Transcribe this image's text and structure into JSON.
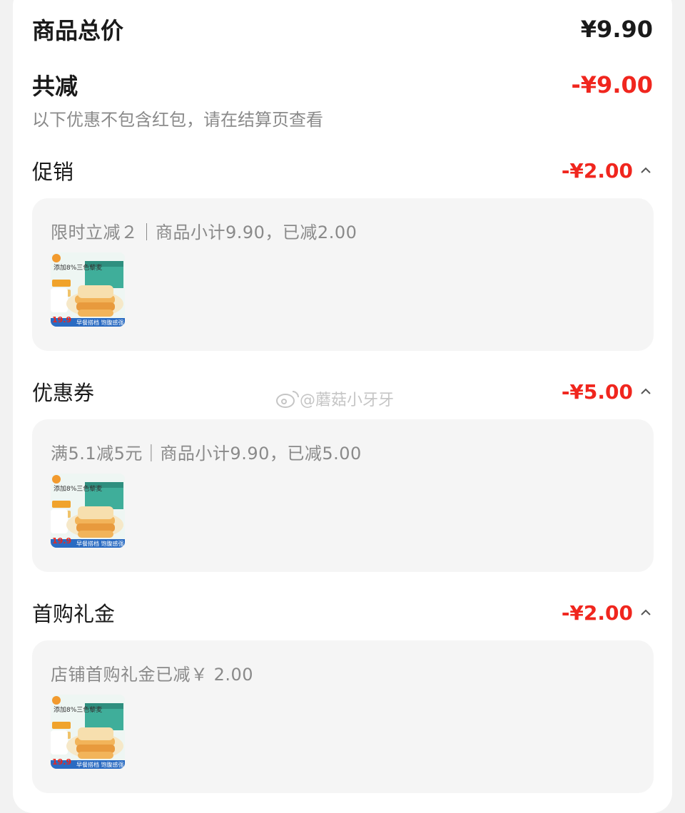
{
  "summary": {
    "total_label": "商品总价",
    "total_value": "¥9.90",
    "reduce_label": "共减",
    "reduce_value": "-¥9.00",
    "note": "以下优惠不包含红包，请在结算页查看"
  },
  "sections": [
    {
      "label": "促销",
      "amount": "-¥2.00",
      "detail": "限时立减２｜商品小计9.90，已减2.00",
      "thumb_price": "19.9",
      "thumb_banner": "早餐搭档 饱腹感强",
      "thumb_title": "添加8%三色藜麦"
    },
    {
      "label": "优惠券",
      "amount": "-¥5.00",
      "detail": "满5.1减5元｜商品小计9.90，已减5.00",
      "thumb_price": "19.9",
      "thumb_banner": "早餐搭档 饱腹感强",
      "thumb_title": "添加8%三色藜麦"
    },
    {
      "label": "首购礼金",
      "amount": "-¥2.00",
      "detail": "店铺首购礼金已减￥ 2.00",
      "thumb_price": "19.9",
      "thumb_banner": "早餐搭档 饱腹感强",
      "thumb_title": "添加8%三色藜麦"
    }
  ],
  "watermark": "@蘑菇小牙牙",
  "colors": {
    "accent_red": "#f0261e",
    "muted_text": "#8a8a8a",
    "card_bg": "#f5f5f5"
  },
  "icons": {
    "expand": "chevron-up-icon",
    "watermark": "weibo-icon"
  }
}
